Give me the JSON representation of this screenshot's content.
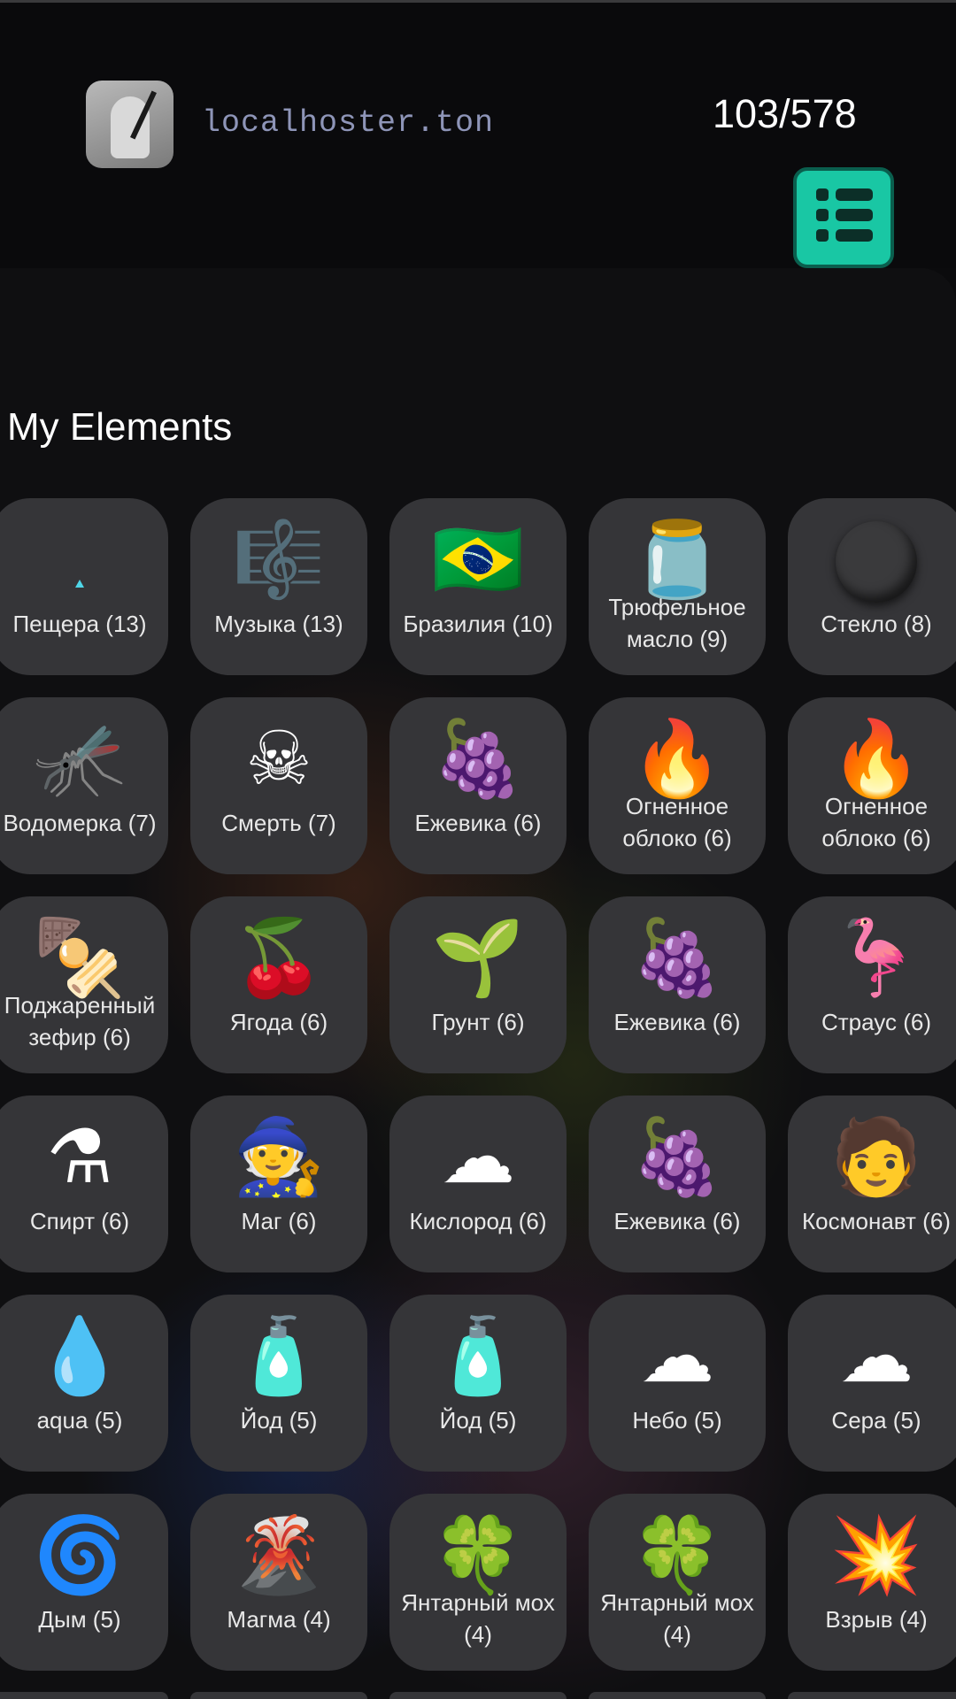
{
  "header": {
    "domain": "localhoster.ton",
    "counter": "103/578"
  },
  "section": {
    "title": "My Elements"
  },
  "elements": [
    {
      "label": "Пещера (13)",
      "icon": "cave-icon"
    },
    {
      "label": "Музыка (13)",
      "icon": "music-icon"
    },
    {
      "label": "Бразилия (10)",
      "icon": "brazil-flag-icon"
    },
    {
      "label": "Трюфельное\nмасло (9)",
      "icon": "truffle-oil-icon"
    },
    {
      "label": "Стекло (8)",
      "icon": "glass-icon"
    },
    {
      "label": "Водомерка (7)",
      "icon": "water-strider-icon"
    },
    {
      "label": "Смерть (7)",
      "icon": "skull-icon"
    },
    {
      "label": "Ежевика (6)",
      "icon": "blackberry-icon"
    },
    {
      "label": "Огненное\nоблоко (6)",
      "icon": "fire-cloud-icon"
    },
    {
      "label": "Огненное\nоблоко (6)",
      "icon": "fire-cloud-icon"
    },
    {
      "label": "Поджаренный\nзефир (6)",
      "icon": "toasted-marshmallow-icon"
    },
    {
      "label": "Ягода (6)",
      "icon": "berry-icon"
    },
    {
      "label": "Грунт (6)",
      "icon": "soil-icon"
    },
    {
      "label": "Ежевика (6)",
      "icon": "blackberry-icon"
    },
    {
      "label": "Страус (6)",
      "icon": "ostrich-icon"
    },
    {
      "label": "Спирт (6)",
      "icon": "alcohol-flask-icon"
    },
    {
      "label": "Маг (6)",
      "icon": "wizard-icon"
    },
    {
      "label": "Кислород (6)",
      "icon": "oxygen-cloud-icon"
    },
    {
      "label": "Ежевика (6)",
      "icon": "blackberry-icon"
    },
    {
      "label": "Космонавт (6)",
      "icon": "astronaut-icon"
    },
    {
      "label": "aqua (5)",
      "icon": "water-drop-icon"
    },
    {
      "label": "Йод (5)",
      "icon": "iodine-bottle-icon"
    },
    {
      "label": "Йод (5)",
      "icon": "iodine-bottle-icon"
    },
    {
      "label": "Небо (5)",
      "icon": "sky-icon"
    },
    {
      "label": "Сера (5)",
      "icon": "sulfur-dioxide-icon"
    },
    {
      "label": "Дым (5)",
      "icon": "smoke-swirl-icon"
    },
    {
      "label": "Магма (4)",
      "icon": "magma-icon"
    },
    {
      "label": "Янтарный мох\n(4)",
      "icon": "amber-moss-icon"
    },
    {
      "label": "Янтарный мох\n(4)",
      "icon": "amber-moss-icon"
    },
    {
      "label": "Взрыв (4)",
      "icon": "explosion-icon"
    }
  ]
}
